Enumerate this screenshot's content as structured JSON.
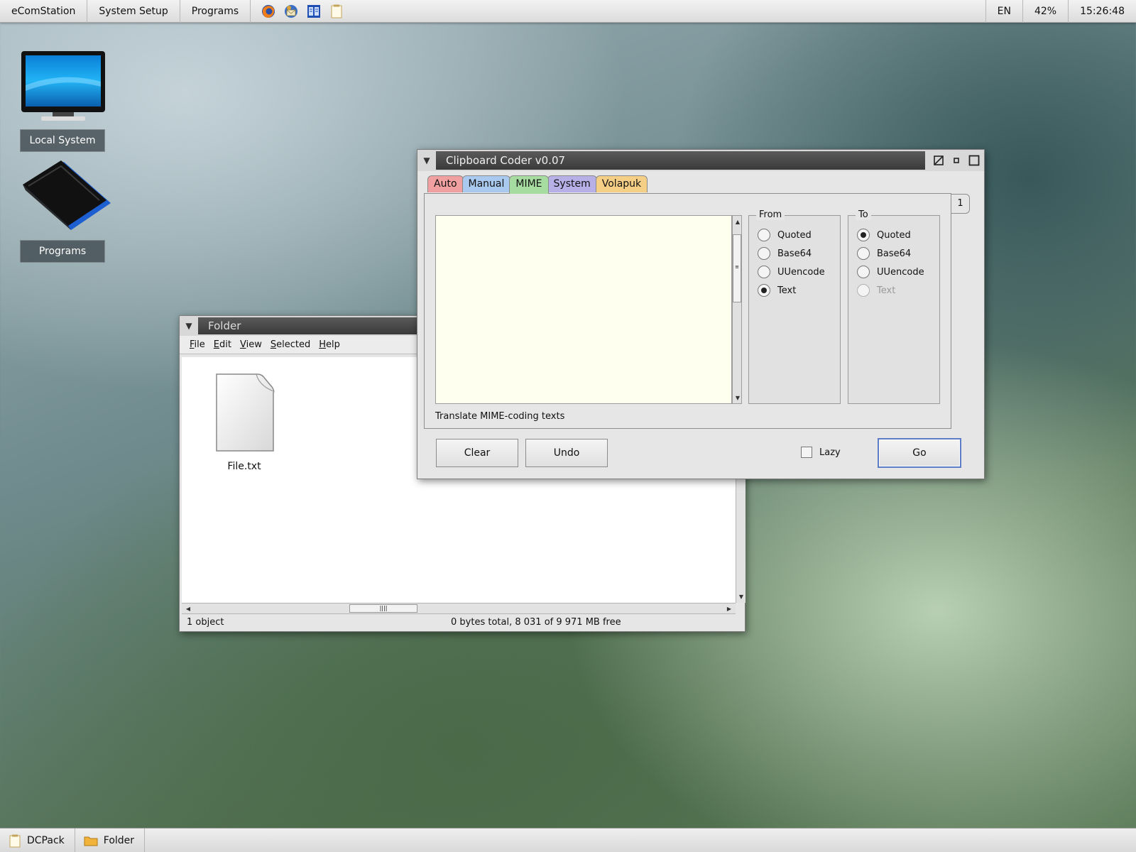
{
  "topbar": {
    "menu": [
      "eComStation",
      "System Setup",
      "Programs"
    ],
    "quick_icons": [
      "firefox-icon",
      "thunderbird-icon",
      "file-manager-icon",
      "notepad-icon"
    ],
    "language": "EN",
    "battery": "42%",
    "clock": "15:26:48"
  },
  "desktop": {
    "icons": [
      {
        "label": "Local System",
        "icon": "monitor-icon"
      },
      {
        "label": "Programs",
        "icon": "programs-folder-icon"
      }
    ]
  },
  "folder_window": {
    "title": "Folder",
    "menu": [
      "File",
      "Edit",
      "View",
      "Selected",
      "Help"
    ],
    "file_label": "File.txt",
    "status_left": "1 object",
    "status_right": "0 bytes total, 8 031 of 9 971 MB free"
  },
  "coder_window": {
    "title": "Clipboard Coder v0.07",
    "tabs": [
      {
        "label": "Auto",
        "color": "#f0a0a0"
      },
      {
        "label": "Manual",
        "color": "#a9c9ee"
      },
      {
        "label": "MIME",
        "color": "#a6dca0"
      },
      {
        "label": "System",
        "color": "#b7b0e6"
      },
      {
        "label": "Volapuk",
        "color": "#f6cf86"
      }
    ],
    "active_tab": "MIME",
    "page_number": "1",
    "from": {
      "label": "From",
      "options": [
        "Quoted",
        "Base64",
        "UUencode",
        "Text"
      ],
      "selected": "Text"
    },
    "to": {
      "label": "To",
      "options": [
        "Quoted",
        "Base64",
        "UUencode",
        "Text"
      ],
      "selected": "Quoted",
      "disabled": "Text"
    },
    "description": "Translate MIME-coding texts",
    "buttons": {
      "clear": "Clear",
      "undo": "Undo",
      "go": "Go"
    },
    "lazy_label": "Lazy",
    "lazy_checked": false
  },
  "taskbar": {
    "tasks": [
      {
        "label": "DCPack",
        "icon": "notepad-icon"
      },
      {
        "label": "Folder",
        "icon": "folder-icon"
      }
    ]
  }
}
